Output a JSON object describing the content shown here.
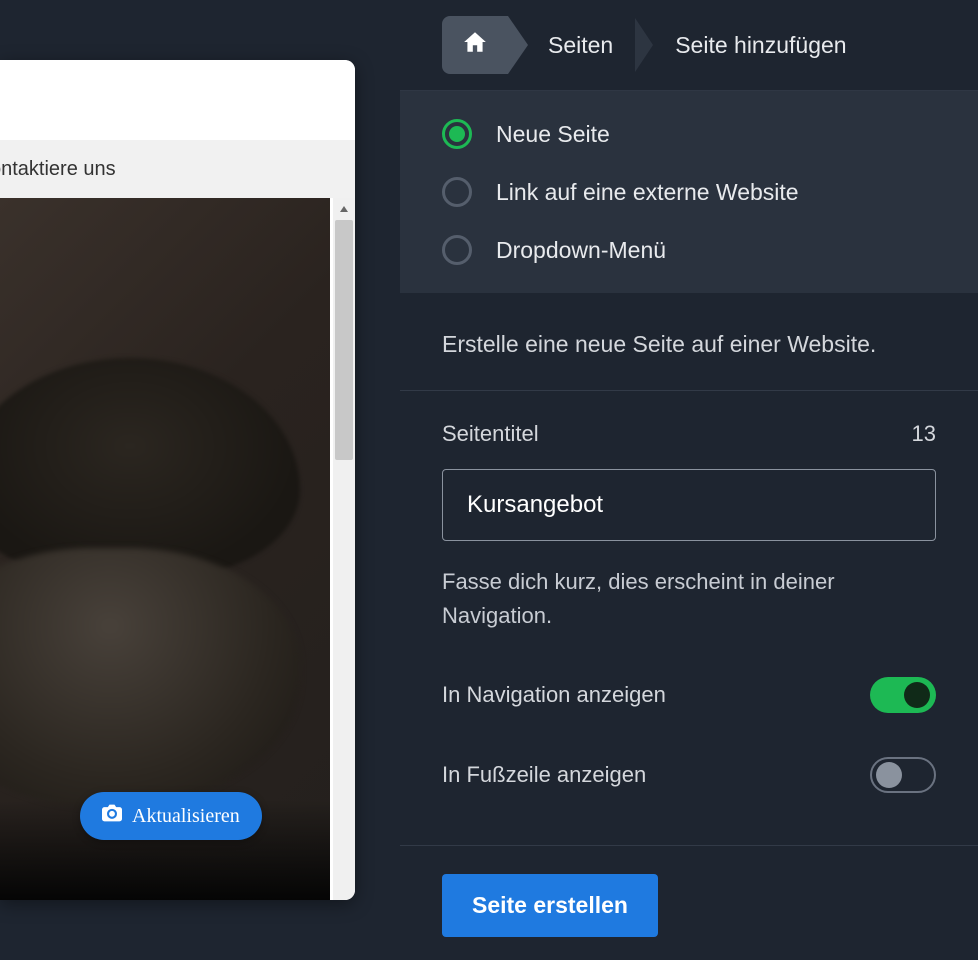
{
  "preview": {
    "menu_item": "ontaktiere uns",
    "update_button": "Aktualisieren"
  },
  "breadcrumb": {
    "items": [
      "Seiten",
      "Seite hinzufügen"
    ]
  },
  "page_type": {
    "options": [
      {
        "label": "Neue Seite",
        "checked": true
      },
      {
        "label": "Link auf eine externe Website",
        "checked": false
      },
      {
        "label": "Dropdown-Menü",
        "checked": false
      }
    ]
  },
  "form": {
    "description": "Erstelle eine neue Seite auf einer Website.",
    "title_label": "Seitentitel",
    "title_count": "13",
    "title_value": "Kursangebot",
    "title_hint": "Fasse dich kurz, dies erscheint in deiner Navigation.",
    "toggle_nav_label": "In Navigation anzeigen",
    "toggle_nav_on": true,
    "toggle_footer_label": "In Fußzeile anzeigen",
    "toggle_footer_on": false,
    "submit_label": "Seite erstellen"
  }
}
